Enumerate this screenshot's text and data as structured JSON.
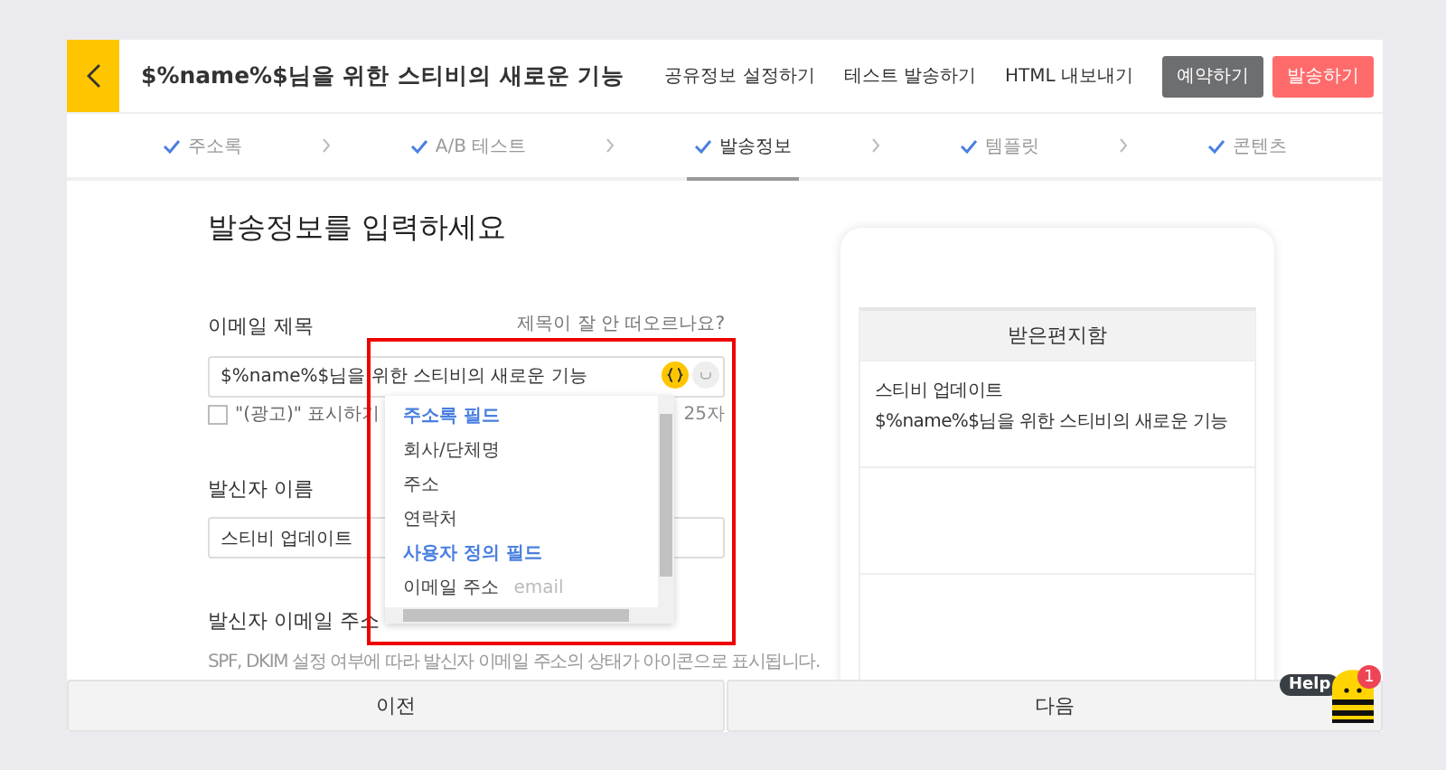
{
  "header": {
    "title": "$%name%$님을 위한 스티비의 새로운 기능",
    "links": [
      "공유정보 설정하기",
      "테스트 발송하기",
      "HTML 내보내기"
    ],
    "buttons": [
      {
        "label": "예약하기",
        "kind": "secondary"
      },
      {
        "label": "발송하기",
        "kind": "primary"
      }
    ]
  },
  "steps": [
    {
      "label": "주소록",
      "done": true,
      "selected": false
    },
    {
      "label": "A/B 테스트",
      "done": true,
      "selected": false
    },
    {
      "label": "발송정보",
      "done": true,
      "selected": true
    },
    {
      "label": "템플릿",
      "done": true,
      "selected": false
    },
    {
      "label": "콘텐츠",
      "done": true,
      "selected": false
    }
  ],
  "form": {
    "heading": "발송정보를 입력하세요",
    "subject": {
      "label": "이메일 제목",
      "hint_link": "제목이 잘 안 떠오르나요?",
      "value": "$%name%$님을 위한 스티비의 새로운 기능",
      "ad_checkbox": {
        "label": "\"(광고)\" 표시하기",
        "checked": false
      },
      "char_count": "25자"
    },
    "sender_name": {
      "label": "발신자 이름",
      "value": "스티비 업데이트"
    },
    "sender_email": {
      "label": "발신자 이메일 주소",
      "description": "SPF, DKIM 설정 여부에 따라 발신자 이메일 주소의 상태가 아이콘으로 표시됩니다."
    }
  },
  "field_dropdown": {
    "groups": [
      {
        "title": "주소록 필드",
        "items": [
          {
            "label": "회사/단체명"
          },
          {
            "label": "주소"
          },
          {
            "label": "연락처"
          }
        ]
      },
      {
        "title": "사용자 정의 필드",
        "items": [
          {
            "label": "이메일 주소",
            "hint": "email"
          }
        ]
      }
    ]
  },
  "preview": {
    "inbox_title": "받은편지함",
    "sender": "스티비 업데이트",
    "subject": "$%name%$님을 위한 스티비의 새로운 기능"
  },
  "footer": {
    "buttons": [
      "이전",
      "다음"
    ]
  },
  "help": {
    "label": "Help",
    "badge": "1"
  }
}
